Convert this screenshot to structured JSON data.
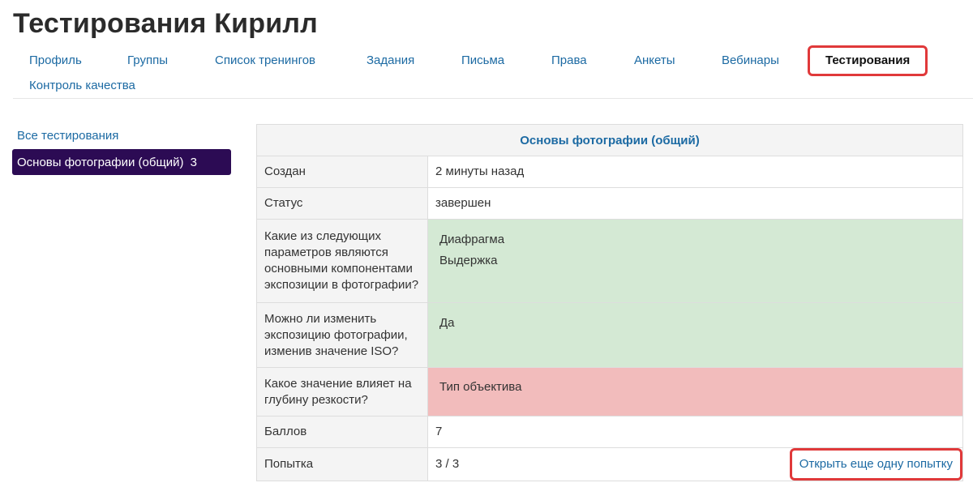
{
  "page": {
    "title": "Тестирования Кирилл"
  },
  "tabs": [
    {
      "label": "Профиль"
    },
    {
      "label": "Группы"
    },
    {
      "label": "Список тренингов"
    },
    {
      "label": "Задания"
    },
    {
      "label": "Письма"
    },
    {
      "label": "Права"
    },
    {
      "label": "Анкеты"
    },
    {
      "label": "Вебинары"
    },
    {
      "label": "Тестирования",
      "active": true
    },
    {
      "label": "Контроль качества"
    }
  ],
  "sidebar": {
    "all_label": "Все тестирования",
    "active_item": {
      "label": "Основы фотографии (общий)",
      "count": "3"
    }
  },
  "result": {
    "title": "Основы фотографии (общий)",
    "created_label": "Создан",
    "created_value": "2 минуты назад",
    "status_label": "Статус",
    "status_value": "завершен",
    "questions": [
      {
        "question": "Какие из следующих параметров являются основными компонентами экспозиции в фотографии?",
        "answers": [
          "Диафрагма",
          "Выдержка"
        ],
        "correct": true
      },
      {
        "question": "Можно ли изменить экспозицию фотографии, изменив значение ISO?",
        "answers": [
          "Да"
        ],
        "correct": true
      },
      {
        "question": "Какое значение влияет на глубину резкости?",
        "answers": [
          "Тип объектива"
        ],
        "correct": false
      }
    ],
    "score_label": "Баллов",
    "score_value": "7",
    "attempt_label": "Попытка",
    "attempt_value": "3 / 3",
    "retry_label": "Открыть еще одну попытку"
  },
  "colors": {
    "link": "#1c6aa3",
    "sidebar_active_bg": "#2c0b54",
    "correct_bg": "#d4e9d4",
    "wrong_bg": "#f2bcbc",
    "highlight_border": "#e0393a"
  }
}
